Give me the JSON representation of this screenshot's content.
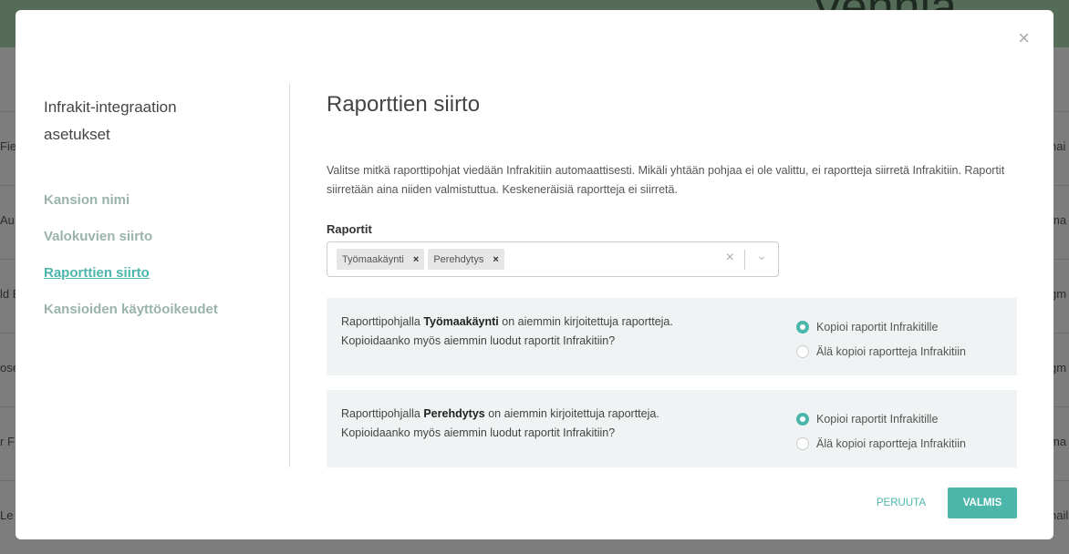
{
  "background": {
    "word": "Vehnia",
    "left_fragments": [
      "Fie",
      "Au",
      "ld E",
      "ose",
      "r F",
      "Le"
    ],
    "right_fragments": [
      "nai",
      "ma",
      "gm",
      "gm",
      "ma",
      "nail"
    ]
  },
  "sidebar": {
    "title": "Infrakit-integraation asetukset",
    "items": [
      {
        "label": "Kansion nimi"
      },
      {
        "label": "Valokuvien siirto"
      },
      {
        "label": "Raporttien siirto",
        "active": true
      },
      {
        "label": "Kansioiden käyttöoikeudet"
      }
    ]
  },
  "main": {
    "title": "Raporttien siirto",
    "description": "Valitse mitkä raporttipohjat viedään Infrakitiin automaattisesti. Mikäli yhtään pohjaa ei ole valittu, ei raportteja siirretä Infrakitiin. Raportit siirretään aina niiden valmistuttua. Keskeneräisiä raportteja ei siirretä.",
    "select_label": "Raportit",
    "selected": [
      {
        "label": "Työmaakäynti",
        "remove": "×"
      },
      {
        "label": "Perehdytys",
        "remove": "×"
      }
    ],
    "clear": "×",
    "chevron": "⌄",
    "questions": [
      {
        "pre": "Raporttipohjalla ",
        "name": "Työmaakäynti",
        "post": " on aiemmin kirjoitettuja raportteja. Kopioidaanko myös aiemmin luodut raportit Infrakitiin?",
        "options": [
          {
            "label": "Kopioi raportit Infrakitille",
            "selected": true
          },
          {
            "label": "Älä kopioi raportteja Infrakitiin",
            "selected": false
          }
        ]
      },
      {
        "pre": "Raporttipohjalla ",
        "name": "Perehdytys",
        "post": " on aiemmin kirjoitettuja raportteja. Kopioidaanko myös aiemmin luodut raportit Infrakitiin?",
        "options": [
          {
            "label": "Kopioi raportit Infrakitille",
            "selected": true
          },
          {
            "label": "Älä kopioi raportteja Infrakitiin",
            "selected": false
          }
        ]
      }
    ]
  },
  "footer": {
    "cancel": "PERUUTA",
    "ok": "VALMIS"
  },
  "close": "×",
  "colors": {
    "accent": "#4bb6a9"
  }
}
